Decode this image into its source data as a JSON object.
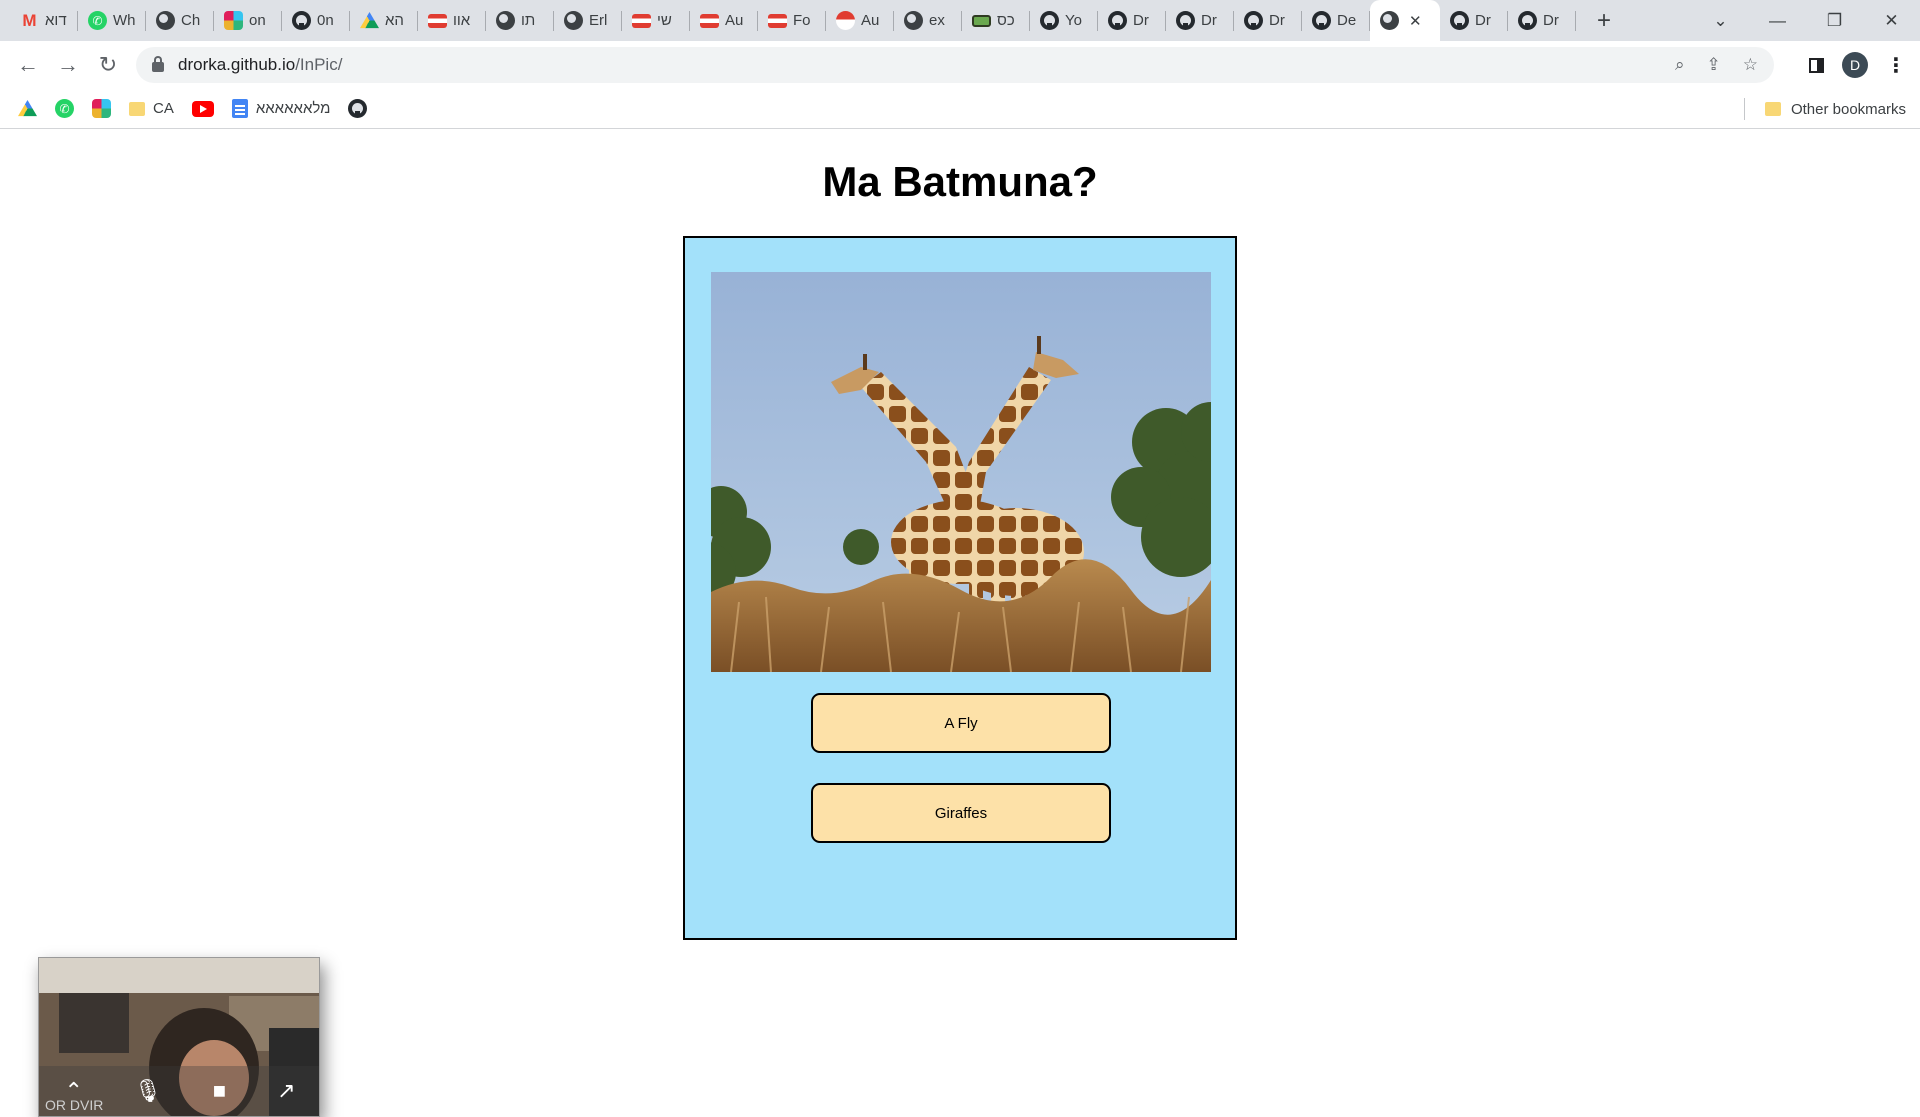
{
  "browser": {
    "tabs": [
      {
        "icon": "gmail-icon",
        "title": "דוא"
      },
      {
        "icon": "whatsapp-icon",
        "title": "Wh"
      },
      {
        "icon": "globe-icon",
        "title": "Ch"
      },
      {
        "icon": "slack-icon",
        "title": "on"
      },
      {
        "icon": "github-icon",
        "title": "0n"
      },
      {
        "icon": "drive-icon",
        "title": "הא"
      },
      {
        "icon": "flag-icon",
        "title": "אוו"
      },
      {
        "icon": "globe-icon",
        "title": "תו"
      },
      {
        "icon": "globe-icon",
        "title": "Erl"
      },
      {
        "icon": "flag-icon",
        "title": "שי"
      },
      {
        "icon": "flag-icon",
        "title": "Au"
      },
      {
        "icon": "flag-icon",
        "title": "Fo"
      },
      {
        "icon": "flag-circle-icon",
        "title": "Au"
      },
      {
        "icon": "globe-icon",
        "title": "ex"
      },
      {
        "icon": "keyboard-icon",
        "title": "כס"
      },
      {
        "icon": "github-icon",
        "title": "Yo"
      },
      {
        "icon": "github-icon",
        "title": "Dr"
      },
      {
        "icon": "github-icon",
        "title": "Dr"
      },
      {
        "icon": "github-icon",
        "title": "Dr"
      },
      {
        "icon": "github-icon",
        "title": "De"
      }
    ],
    "active_tab_icon": "globe-icon",
    "tabs_after": [
      {
        "icon": "github-icon",
        "title": "Dr"
      },
      {
        "icon": "github-icon",
        "title": "Dr"
      }
    ],
    "url_host": "drorka.github.io",
    "url_path": "/InPic/",
    "profile_initial": "D",
    "bookmarks": {
      "folder_ca": "CA",
      "doc_label": "מלאאאאאא",
      "other": "Other bookmarks"
    }
  },
  "page": {
    "title": "Ma Batmuna?",
    "image_subject": "two giraffes in grassland",
    "answers": [
      "A Fly",
      "Giraffes"
    ]
  },
  "video": {
    "name": "OR DVIR"
  },
  "colors": {
    "card_bg": "#a3e1fa",
    "answer_bg": "#fde1a8",
    "tabstrip_bg": "#dee1e6"
  }
}
